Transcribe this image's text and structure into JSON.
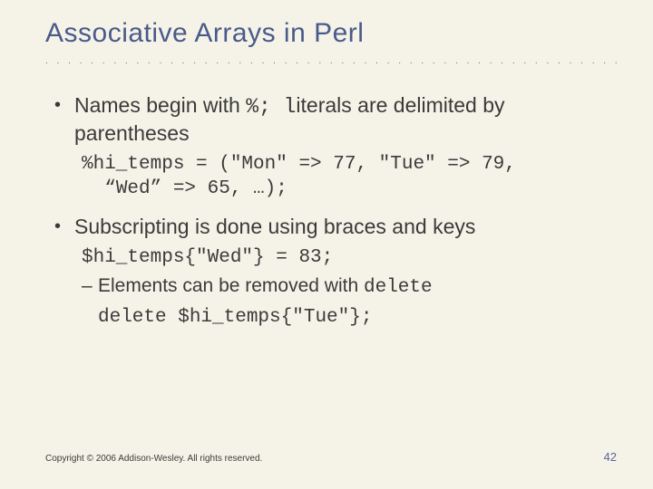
{
  "title": "Associative Arrays in Perl",
  "bullets": {
    "b1_pre": "Names begin with ",
    "b1_code1": "%; l",
    "b1_post": "iterals are delimited by parentheses",
    "code1": "%hi_temps = (\"Mon\" => 77, \"Tue\" => 79,\n  “Wed” => 65, …);",
    "b2": "Subscripting is done using braces and keys",
    "code2": "$hi_temps{\"Wed\"} = 83;",
    "sub1_pre": "Elements can be removed with ",
    "sub1_code": "delete",
    "code3": "delete $hi_temps{\"Tue\"};"
  },
  "footer": {
    "copyright": "Copyright © 2006 Addison-Wesley. All rights reserved.",
    "page": "42"
  }
}
